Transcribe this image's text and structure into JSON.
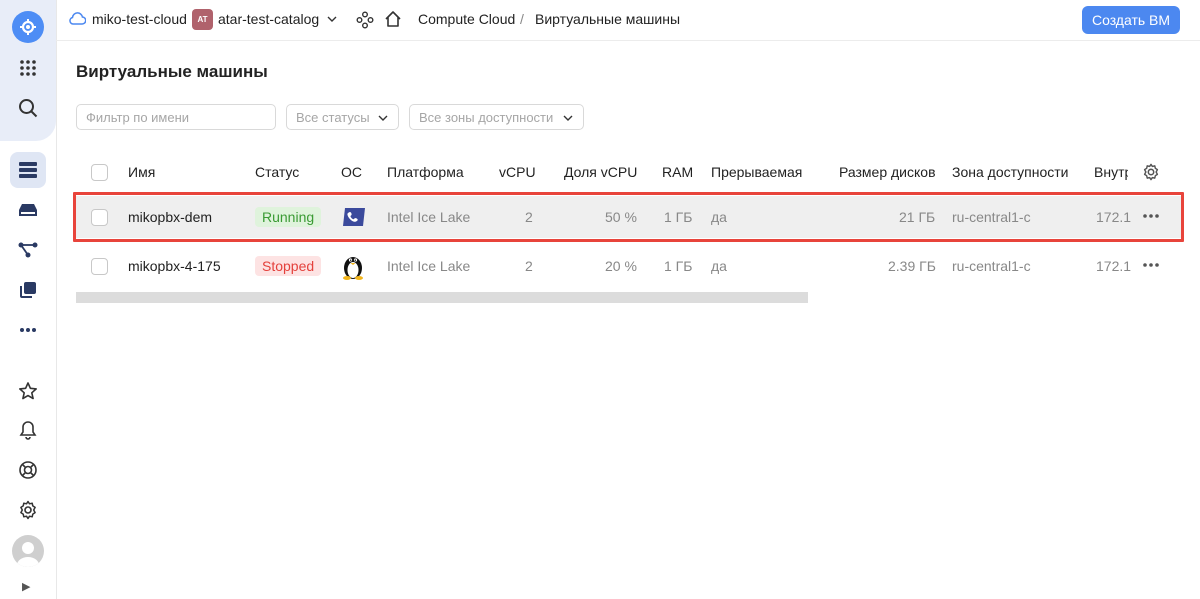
{
  "sidebar": {
    "items": [
      {
        "icon": "grid-apps-icon"
      },
      {
        "icon": "search-icon"
      },
      {
        "icon": "server-list-icon"
      },
      {
        "icon": "disk-icon"
      },
      {
        "icon": "network-icon"
      },
      {
        "icon": "copy-icon"
      },
      {
        "icon": "more-icon"
      },
      {
        "icon": "star-icon"
      },
      {
        "icon": "bell-icon"
      },
      {
        "icon": "support-icon"
      },
      {
        "icon": "gear-icon"
      }
    ]
  },
  "breadcrumbs": {
    "cloud": "miko-test-cloud",
    "catalog_badge": "AT",
    "catalog": "atar-test-catalog",
    "service": "Compute Cloud",
    "separator": "/",
    "current": "Виртуальные машины"
  },
  "actions": {
    "create_vm": "Создать ВМ"
  },
  "page": {
    "title": "Виртуальные машины"
  },
  "filters": {
    "name_placeholder": "Фильтр по имени",
    "status_select": "Все статусы",
    "zone_select": "Все зоны доступности"
  },
  "table": {
    "columns": [
      "Имя",
      "Статус",
      "ОС",
      "Платформа",
      "vCPU",
      "Доля vCPU",
      "RAM",
      "Прерываемая",
      "Размер дисков",
      "Зона доступности",
      "Внутр"
    ],
    "rows": [
      {
        "name": "mikopbx-dem",
        "status": "Running",
        "os": "phone-os-icon",
        "platform": "Intel Ice Lake",
        "vcpu": "2",
        "vcpu_share": "50 %",
        "ram": "1 ГБ",
        "preemptible": "да",
        "disk": "21 ГБ",
        "zone": "ru-central1-c",
        "ip": "172.1",
        "selected": true
      },
      {
        "name": "mikopbx-4-175",
        "status": "Stopped",
        "os": "linux-penguin-icon",
        "platform": "Intel Ice Lake",
        "vcpu": "2",
        "vcpu_share": "20 %",
        "ram": "1 ГБ",
        "preemptible": "да",
        "disk": "2.39 ГБ",
        "zone": "ru-central1-c",
        "ip": "172.1",
        "selected": false
      }
    ]
  },
  "colors": {
    "accent": "#4c88f0",
    "running": "#3a9b34",
    "stopped": "#e4413c",
    "highlight": "#e8443b"
  }
}
